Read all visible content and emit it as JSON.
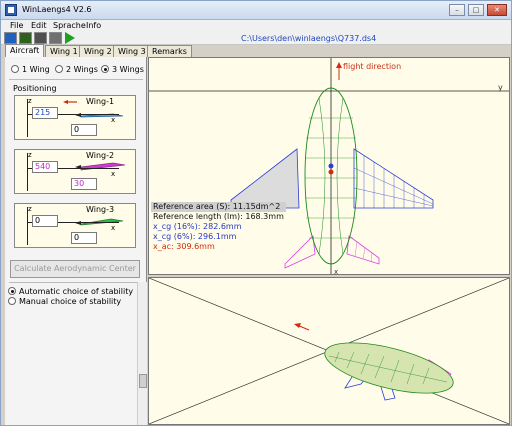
{
  "window": {
    "title": "WinLaengs4  V2.6",
    "minimize_glyph": "–",
    "maximize_glyph": "□",
    "close_glyph": "✕"
  },
  "menu": [
    "File",
    "Edit",
    "Sprache",
    "Info"
  ],
  "toolbar": {
    "icons": [
      "open-folder-icon",
      "open-icon",
      "save-icon",
      "print-icon",
      "run-icon"
    ],
    "file_path": "C:\\Users\\den\\winlaengs\\Q737.ds4"
  },
  "tabs": [
    {
      "label": "Aircraft",
      "active": true
    },
    {
      "label": "Wing 1",
      "active": false
    },
    {
      "label": "Wing 2",
      "active": false
    },
    {
      "label": "Wing 3",
      "active": false
    },
    {
      "label": "Remarks",
      "active": false
    }
  ],
  "wing_count": {
    "options": [
      "1 Wing",
      "2 Wings",
      "3 Wings"
    ],
    "selected": "3 Wings"
  },
  "positioning": {
    "label": "Positioning",
    "axis_z": "z",
    "axis_x": "x",
    "wings": [
      {
        "name": "Wing-1",
        "x_value": "215",
        "z_value": "0",
        "name_color": "#111111",
        "value_color": "#1b49c0",
        "z_color": "#111111",
        "fill": "#4fa8ee"
      },
      {
        "name": "Wing-2",
        "x_value": "540",
        "z_value": "30",
        "name_color": "#111111",
        "value_color": "#c02bc0",
        "z_color": "#c02bc0",
        "fill": "#cc3ed2"
      },
      {
        "name": "Wing-3",
        "x_value": "0",
        "z_value": "0",
        "name_color": "#111111",
        "value_color": "#111111",
        "z_color": "#111111",
        "fill": "#2fbf45"
      }
    ]
  },
  "calculate_button": "Calculate Aerodynamic Center",
  "stability": {
    "options": [
      "Automatic choice of stability",
      "Manual choice of stability"
    ],
    "selected": "Automatic choice of stability"
  },
  "top_view": {
    "flight_direction": "flight direction",
    "axis_y": "y",
    "axis_x": "x",
    "reference_area": "Reference area (S): 11.15dm^2",
    "reference_length": "Reference length (lm): 168.3mm",
    "x_cg_16": "x_cg (16%): 282.6mm",
    "x_cg_6": "x_cg (6%): 296.1mm",
    "x_ac": "x_ac: 309.6mm"
  },
  "colors": {
    "wing1": "#2b3ed8",
    "wing2": "#d83fe0",
    "fuselage": "#1c8a1c",
    "arrow": "#d22b12",
    "panel_bg": "#fffde9"
  }
}
